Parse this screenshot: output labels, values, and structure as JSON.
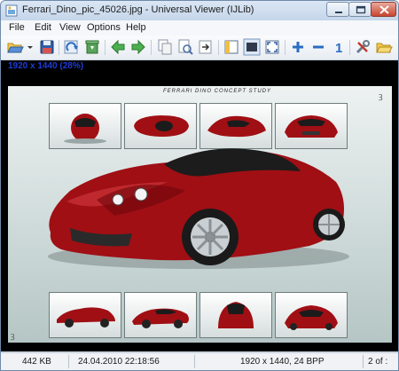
{
  "window": {
    "title": "Ferrari_Dino_pic_45026.jpg - Universal Viewer (IJLib)"
  },
  "menu": {
    "items": [
      "File",
      "Edit",
      "View",
      "Options",
      "Help"
    ]
  },
  "toolbar": {
    "buttons": [
      "open-folder-icon",
      "dropdown-arrow-icon",
      "save-icon",
      "refresh-icon",
      "recycle-bin-icon",
      "arrow-left-icon",
      "arrow-right-icon",
      "copy-icon",
      "preview-icon",
      "paste-icon",
      "panel-icon",
      "fit-window-icon",
      "fullscreen-icon",
      "zoom-in-icon",
      "zoom-out-icon",
      "actual-size-icon",
      "tools-icon",
      "folder-open-icon"
    ],
    "actual_size_label": "1"
  },
  "viewer": {
    "image_dimensions_overlay": "1920 x 1440 (28%)",
    "photo_caption": "FERRARI DINO CONCEPT STUDY",
    "corner_mark": "ꝫ",
    "colors": {
      "car_red": "#a00f14",
      "background": "#000000",
      "overlay_text": "#1f3bd8"
    }
  },
  "statusbar": {
    "file_size": "442 KB",
    "date": "24.04.2010 22:18:56",
    "image_info": "1920 x 1440, 24 BPP",
    "page": "2 of :"
  }
}
